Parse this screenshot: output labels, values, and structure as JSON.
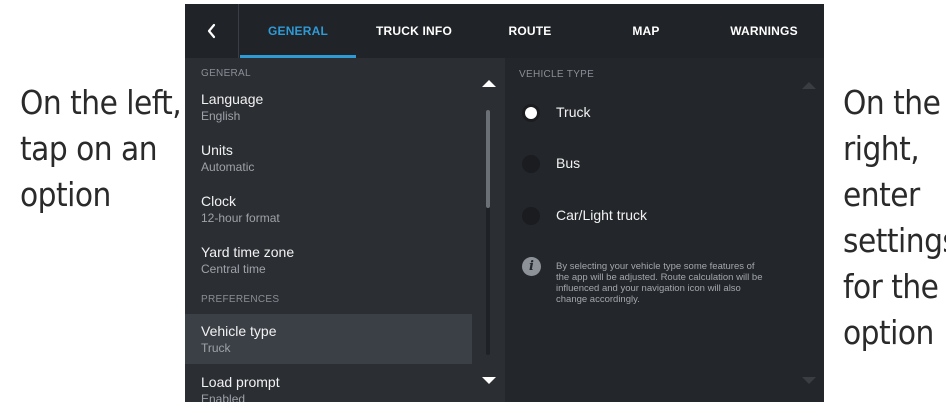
{
  "captions": {
    "left": [
      "On the left,",
      "tap on an",
      "option"
    ],
    "right": [
      "On the",
      "right,",
      "enter",
      "settings",
      "for the",
      "option"
    ]
  },
  "nav": {
    "back_icon": "chevron-left-icon",
    "tabs": [
      {
        "label": "GENERAL",
        "active": true
      },
      {
        "label": "TRUCK INFO",
        "active": false
      },
      {
        "label": "ROUTE",
        "active": false
      },
      {
        "label": "MAP",
        "active": false
      },
      {
        "label": "WARNINGS",
        "active": false
      }
    ]
  },
  "left_pane": {
    "sections": {
      "general": "GENERAL",
      "preferences": "PREFERENCES"
    },
    "settings": [
      {
        "label": "Language",
        "value": "English"
      },
      {
        "label": "Units",
        "value": "Automatic"
      },
      {
        "label": "Clock",
        "value": "12-hour format"
      },
      {
        "label": "Yard time zone",
        "value": "Central time"
      },
      {
        "label": "Vehicle type",
        "value": "Truck",
        "selected": true
      },
      {
        "label": "Load prompt",
        "value": "Enabled"
      }
    ]
  },
  "right_pane": {
    "header": "VEHICLE TYPE",
    "options": [
      {
        "label": "Truck",
        "checked": true
      },
      {
        "label": "Bus",
        "checked": false
      },
      {
        "label": "Car/Light truck",
        "checked": false
      }
    ],
    "info_icon": "info-icon",
    "info_glyph": "i",
    "info_text": "By selecting your vehicle type some features of the app will be adjusted. Route calculation will be influenced and your navigation icon will also change accordingly."
  },
  "colors": {
    "accent": "#2f9bd6",
    "topbar": "#202327",
    "left_pane": "#2b2e33",
    "right_pane": "#23262a",
    "selected_row": "#3b3f46"
  }
}
